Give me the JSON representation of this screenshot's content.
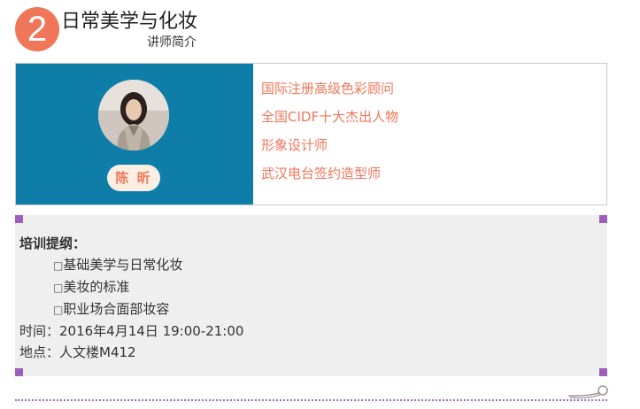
{
  "header": {
    "step_number": "2",
    "title": "日常美学与化妆",
    "subtitle": "讲师简介"
  },
  "instructor": {
    "name": "陈 昕",
    "titles": [
      "国际注册高级色彩顾问",
      "全国CIDF十大杰出人物",
      "形象设计师",
      "武汉电台签约造型师"
    ]
  },
  "outline": {
    "heading": "培训提纲：",
    "item_marker": "□",
    "items": [
      "基础美学与日常化妆",
      "美妆的标准",
      "职业场合面部妆容"
    ],
    "time": "时间：2016年4月14日 19:00-21:00",
    "location": "地点：人文楼M412"
  },
  "colors": {
    "accent": "#f0765a",
    "panel_blue": "#0e7da8",
    "corner_purple": "#9d5ebc",
    "outline_bg": "#efefef"
  },
  "icons": [
    "scissors-icon"
  ]
}
